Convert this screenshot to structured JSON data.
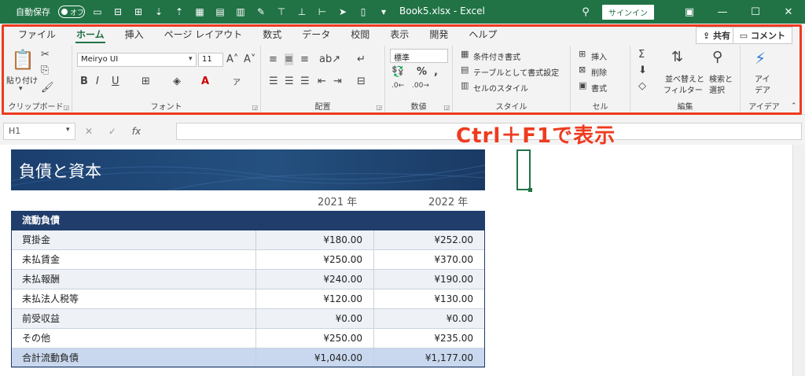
{
  "titlebar": {
    "autosave_label": "自動保存",
    "autosave_state": "オフ",
    "file_title": "Book5.xlsx - Excel",
    "signin_label": "サインイン"
  },
  "tabs": [
    "ファイル",
    "ホーム",
    "挿入",
    "ページ レイアウト",
    "数式",
    "データ",
    "校閲",
    "表示",
    "開発",
    "ヘルプ"
  ],
  "active_tab": "ホーム",
  "share_label": "共有",
  "comment_label": "コメント",
  "ribbon": {
    "clipboard": {
      "paste": "貼り付け",
      "label": "クリップボード"
    },
    "font": {
      "name": "Meiryo UI",
      "size": "11",
      "label": "フォント"
    },
    "alignment": {
      "label": "配置"
    },
    "number": {
      "format": "標準",
      "label": "数値"
    },
    "styles": {
      "conditional": "条件付き書式",
      "table": "テーブルとして書式設定",
      "cell_styles": "セルのスタイル",
      "label": "スタイル"
    },
    "cells": {
      "insert": "挿入",
      "delete": "削除",
      "format": "書式",
      "label": "セル"
    },
    "editing": {
      "sort": "並べ替えと",
      "sort2": "フィルター",
      "find": "検索と",
      "find2": "選択",
      "label": "編集"
    },
    "ideas": {
      "btn": "アイ",
      "btn2": "デア",
      "label": "アイデア"
    }
  },
  "formula_bar": {
    "name_box": "H1",
    "fx": "fx"
  },
  "callout": "Ctrl＋F1で表示",
  "sheet": {
    "banner_title": "負債と資本",
    "year1": "2021 年",
    "year2": "2022 年",
    "section_header": "流動負債",
    "rows": [
      {
        "label": "買掛金",
        "v2021": "¥180.00",
        "v2022": "¥252.00"
      },
      {
        "label": "未払賃金",
        "v2021": "¥250.00",
        "v2022": "¥370.00"
      },
      {
        "label": "未払報酬",
        "v2021": "¥240.00",
        "v2022": "¥190.00"
      },
      {
        "label": "未払法人税等",
        "v2021": "¥120.00",
        "v2022": "¥130.00"
      },
      {
        "label": "前受収益",
        "v2021": "¥0.00",
        "v2022": "¥0.00"
      },
      {
        "label": "その他",
        "v2021": "¥250.00",
        "v2022": "¥235.00"
      }
    ],
    "total": {
      "label": "合計流動負債",
      "v2021": "¥1,040.00",
      "v2022": "¥1,177.00"
    }
  },
  "colors": {
    "excel_green": "#217346",
    "callout_red": "#ee3b1f",
    "table_header": "#203d6b"
  }
}
